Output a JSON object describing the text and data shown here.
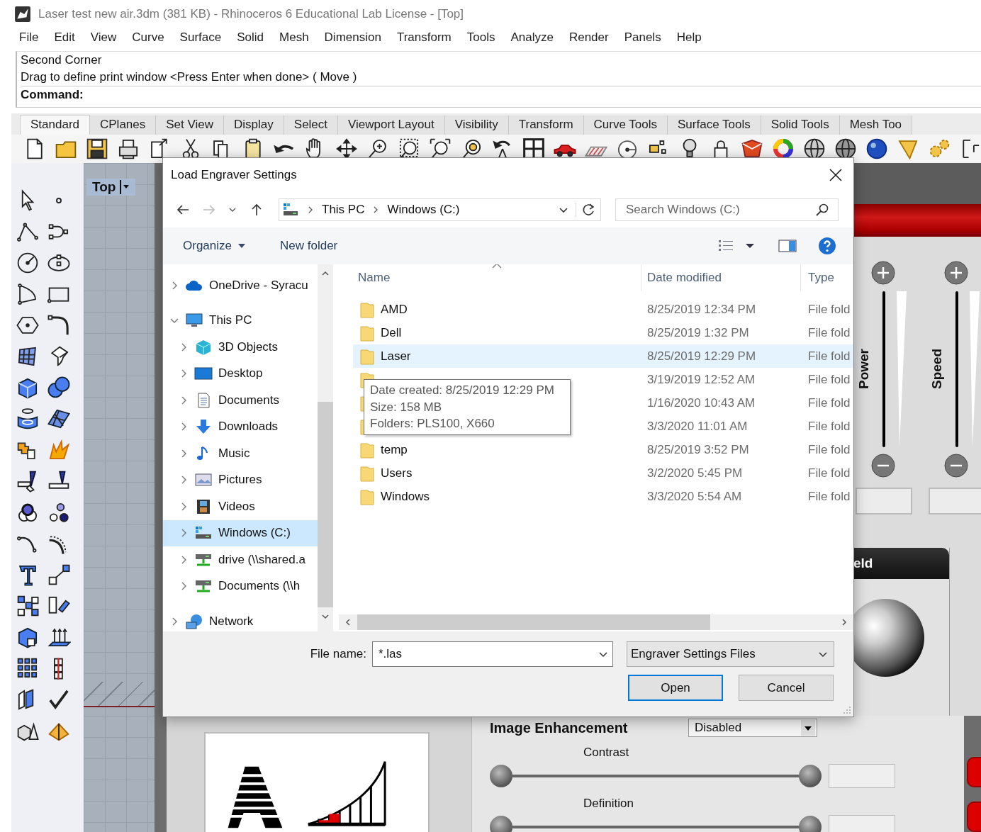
{
  "window": {
    "title": "Laser test new air.3dm (381 KB) - Rhinoceros 6 Educational Lab License - [Top]"
  },
  "menu": [
    "File",
    "Edit",
    "View",
    "Curve",
    "Surface",
    "Solid",
    "Mesh",
    "Dimension",
    "Transform",
    "Tools",
    "Analyze",
    "Render",
    "Panels",
    "Help"
  ],
  "command_history": [
    "Second Corner",
    "Drag to define print window <Press Enter when done> ( Move )"
  ],
  "command_prompt": "Command:",
  "toolbar_tabs": [
    {
      "label": "Standard",
      "selected": true
    },
    {
      "label": "CPlanes",
      "selected": false
    },
    {
      "label": "Set View",
      "selected": false
    },
    {
      "label": "Display",
      "selected": false
    },
    {
      "label": "Select",
      "selected": false
    },
    {
      "label": "Viewport Layout",
      "selected": false
    },
    {
      "label": "Visibility",
      "selected": false
    },
    {
      "label": "Transform",
      "selected": false
    },
    {
      "label": "Curve Tools",
      "selected": false
    },
    {
      "label": "Surface Tools",
      "selected": false
    },
    {
      "label": "Solid Tools",
      "selected": false
    },
    {
      "label": "Mesh Too",
      "selected": false
    }
  ],
  "viewport": {
    "label": "Top"
  },
  "dialog": {
    "title": "Load Engraver Settings",
    "address": [
      "This PC",
      "Windows (C:)"
    ],
    "search": {
      "placeholder": "Search Windows (C:)"
    },
    "commands": [
      "Organize",
      "New folder"
    ],
    "tree": [
      {
        "label": "OneDrive - Syracu",
        "kind": "cloud",
        "expanded": false,
        "selected": false
      },
      {
        "label": "This PC",
        "kind": "computer",
        "expanded": true,
        "selected": false,
        "children": [
          {
            "label": "3D Objects",
            "kind": "objects",
            "expanded": false,
            "selected": false
          },
          {
            "label": "Desktop",
            "kind": "desktop",
            "expanded": false,
            "selected": false
          },
          {
            "label": "Documents",
            "kind": "documents",
            "expanded": false,
            "selected": false
          },
          {
            "label": "Downloads",
            "kind": "downloads",
            "expanded": false,
            "selected": false
          },
          {
            "label": "Music",
            "kind": "music",
            "expanded": false,
            "selected": false
          },
          {
            "label": "Pictures",
            "kind": "pictures",
            "expanded": false,
            "selected": false
          },
          {
            "label": "Videos",
            "kind": "videos",
            "expanded": false,
            "selected": false
          },
          {
            "label": "Windows (C:)",
            "kind": "drive",
            "expanded": false,
            "selected": true
          },
          {
            "label": "drive (\\\\shared.a",
            "kind": "network-drive",
            "expanded": false,
            "selected": false
          },
          {
            "label": "Documents (\\\\h",
            "kind": "network-drive",
            "expanded": false,
            "selected": false
          }
        ]
      },
      {
        "label": "Network",
        "kind": "network",
        "expanded": false,
        "selected": false
      }
    ],
    "columns": [
      "Name",
      "Date modified",
      "Type"
    ],
    "rows": [
      {
        "name": "AMD",
        "date": "8/25/2019 12:34 PM",
        "type": "File fold",
        "hovered": false
      },
      {
        "name": "Dell",
        "date": "8/25/2019 1:32 PM",
        "type": "File fold",
        "hovered": false
      },
      {
        "name": "Laser",
        "date": "8/25/2019 12:29 PM",
        "type": "File fold",
        "hovered": true
      },
      {
        "date": "3/19/2019 12:52 AM",
        "type": "File fold",
        "hovered": false
      },
      {
        "date": "1/16/2020 10:43 AM",
        "type": "File fold",
        "hovered": false
      },
      {
        "date": "3/3/2020 11:01 AM",
        "type": "File fold",
        "hovered": false
      },
      {
        "name": "temp",
        "date": "8/25/2019 3:52 PM",
        "type": "File fold",
        "hovered": false
      },
      {
        "name": "Users",
        "date": "3/2/2020 5:45 PM",
        "type": "File fold",
        "hovered": false
      },
      {
        "name": "Windows",
        "date": "3/3/2020 5:54 AM",
        "type": "File fold",
        "hovered": false
      }
    ],
    "tooltip": [
      "Date created: 8/25/2019 12:29 PM",
      "Size: 158 MB",
      "Folders: PLS100, X660"
    ],
    "file_name": {
      "label": "File name:",
      "value": "*.las"
    },
    "file_type": "Engraver Settings Files",
    "buttons": [
      {
        "label": "Open",
        "default": true
      },
      {
        "label": "Cancel",
        "default": false
      }
    ]
  },
  "engraver": {
    "vertical_sliders": [
      {
        "label": "Power"
      },
      {
        "label": "Speed"
      }
    ],
    "panel_title": "eld",
    "enhancement": {
      "label": "Image Enhancement",
      "mode": "Disabled",
      "sliders": [
        "Contrast",
        "Definition"
      ]
    }
  }
}
